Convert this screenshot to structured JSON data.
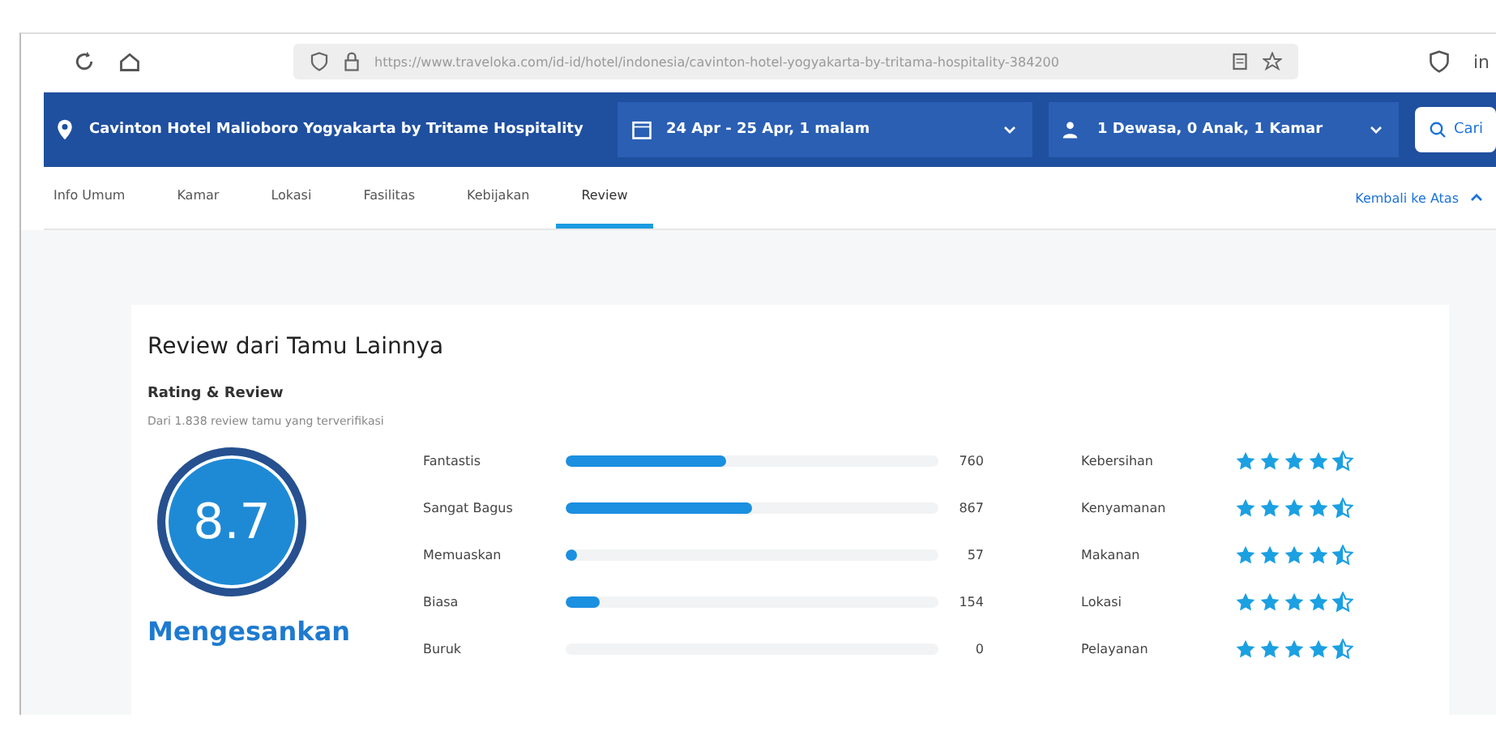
{
  "browser": {
    "url": "https://www.traveloka.com/id-id/hotel/indonesia/cavinton-hotel-yogyakarta-by-tritama-hospitality-384200",
    "extension_label": "in"
  },
  "search_bar": {
    "hotel": "Cavinton Hotel Malioboro Yogyakarta by Tritame Hospitality",
    "dates": "24 Apr - 25 Apr, 1 malam",
    "guests": "1 Dewasa, 0 Anak, 1 Kamar",
    "search_button": "Cari"
  },
  "tabs": [
    {
      "label": "Info Umum",
      "selected": false
    },
    {
      "label": "Kamar",
      "selected": false
    },
    {
      "label": "Lokasi",
      "selected": false
    },
    {
      "label": "Fasilitas",
      "selected": false
    },
    {
      "label": "Kebijakan",
      "selected": false
    },
    {
      "label": "Review",
      "selected": true
    }
  ],
  "back_to_top": "Kembali ke Atas",
  "review": {
    "title": "Review dari Tamu Lainnya",
    "subtitle": "Rating & Review",
    "note": "Dari 1.838 review tamu yang terverifikasi",
    "score": "8.7",
    "verdict": "Mengesankan",
    "distribution": [
      {
        "label": "Fantastis",
        "level": 0.43,
        "count": "760"
      },
      {
        "label": "Sangat Bagus",
        "level": 0.5,
        "count": "867"
      },
      {
        "label": "Memuaskan",
        "level": 0.03,
        "count": "57"
      },
      {
        "label": "Biasa",
        "level": 0.09,
        "count": "154"
      },
      {
        "label": "Buruk",
        "count": "0"
      }
    ],
    "aspects": [
      {
        "label": "Kebersihan",
        "stars": 4.5
      },
      {
        "label": "Kenyamanan",
        "stars": 4.5
      },
      {
        "label": "Makanan",
        "stars": 4.5
      },
      {
        "label": "Lokasi",
        "stars": 4.5
      },
      {
        "label": "Pelayanan",
        "stars": 4.5
      }
    ]
  }
}
